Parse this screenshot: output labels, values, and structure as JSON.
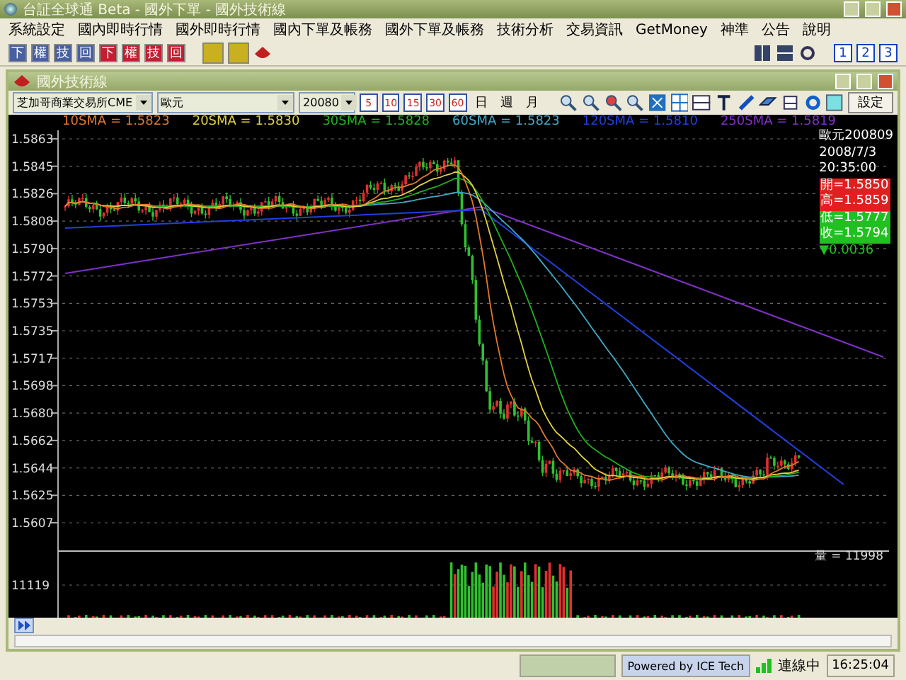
{
  "window": {
    "title": "台証全球通 Beta - 國外下單 - 國外技術線"
  },
  "menu": [
    "系統設定",
    "國內即時行情",
    "國外即時行情",
    "國內下單及帳務",
    "國外下單及帳務",
    "技術分析",
    "交易資訊",
    "GetMoney",
    "神準",
    "公告",
    "說明"
  ],
  "toolbar": {
    "left": [
      {
        "label": "下",
        "kind": "blue"
      },
      {
        "label": "權",
        "kind": "blue"
      },
      {
        "label": "技",
        "kind": "blue"
      },
      {
        "label": "回",
        "kind": "blue"
      },
      {
        "label": "下",
        "kind": "red"
      },
      {
        "label": "權",
        "kind": "red"
      },
      {
        "label": "技",
        "kind": "red"
      },
      {
        "label": "回",
        "kind": "red"
      }
    ],
    "layouts": [
      "1",
      "2",
      "3"
    ]
  },
  "inner_window": {
    "title": "國外技術線"
  },
  "chart_toolbar": {
    "exchange": "芝加哥商業交易所CME",
    "symbol": "歐元",
    "contract": "20080",
    "intervals": [
      "5",
      "10",
      "15",
      "30",
      "60"
    ],
    "periods": [
      "日",
      "週",
      "月"
    ],
    "settings_button": "設定"
  },
  "legend": [
    {
      "label": "10SMA = 1.5823",
      "color": "#e0782a"
    },
    {
      "label": "20SMA = 1.5830",
      "color": "#e0d040"
    },
    {
      "label": "30SMA = 1.5828",
      "color": "#20b020"
    },
    {
      "label": "60SMA = 1.5823",
      "color": "#40a8c8"
    },
    {
      "label": "120SMA = 1.5810",
      "color": "#2040e0"
    },
    {
      "label": "250SMA = 1.5819",
      "color": "#8030c8"
    }
  ],
  "price_axis": [
    "1.5863",
    "1.5845",
    "1.5826",
    "1.5808",
    "1.5790",
    "1.5772",
    "1.5753",
    "1.5735",
    "1.5717",
    "1.5698",
    "1.5680",
    "1.5662",
    "1.5644",
    "1.5625",
    "1.5607"
  ],
  "volume_axis": [
    "11119"
  ],
  "volume_label": "量 = 11998",
  "quote": [
    {
      "text": "歐元200809",
      "kind": "plain",
      "color": "#ffffff"
    },
    {
      "text": "2008/7/3",
      "kind": "plain",
      "color": "#ffffff"
    },
    {
      "text": "20:35:00",
      "kind": "plain",
      "color": "#ffffff"
    },
    {
      "text": "開=1.5850",
      "kind": "boxed",
      "color": "#e02020"
    },
    {
      "text": "高=1.5859",
      "kind": "boxed",
      "color": "#e02020"
    },
    {
      "text": "低=1.5777",
      "kind": "boxed",
      "color": "#20c020"
    },
    {
      "text": "收=1.5794",
      "kind": "boxed",
      "color": "#20c020"
    },
    {
      "text": "▼0.0036",
      "kind": "plain",
      "color": "#20c020"
    }
  ],
  "status_bar": {
    "powered": "Powered by ICE Tech",
    "connection": "連線中",
    "time": "16:25:04"
  }
}
